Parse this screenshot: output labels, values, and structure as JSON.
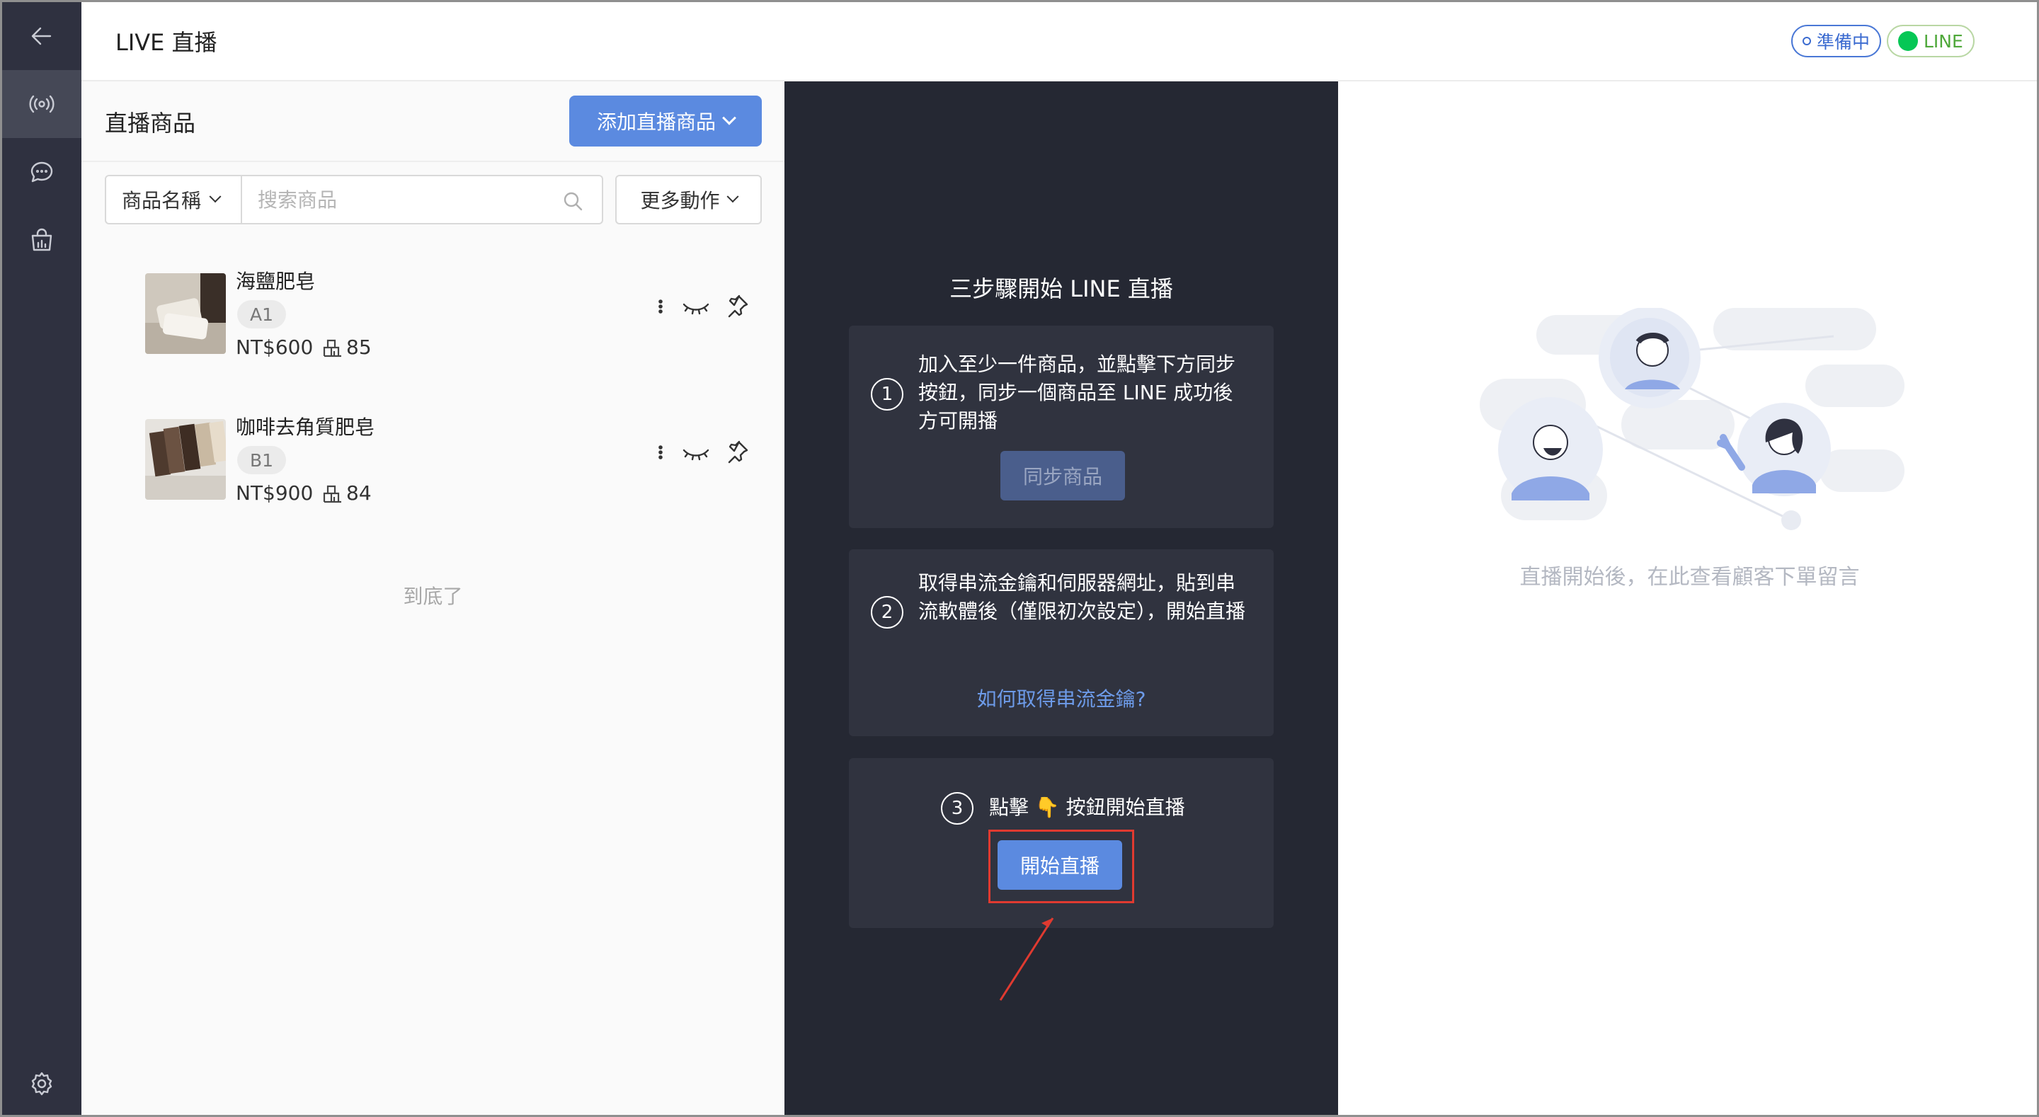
{
  "header": {
    "title": "LIVE 直播",
    "status_label": "準備中",
    "channel_label": "LINE",
    "channel_icon_text": "LINE"
  },
  "sidebar": {
    "items": [
      {
        "icon": "back-arrow-icon"
      },
      {
        "icon": "live-broadcast-icon",
        "active": true
      },
      {
        "icon": "chat-icon"
      },
      {
        "icon": "shop-bag-icon"
      },
      {
        "icon": "gear-icon"
      }
    ]
  },
  "products_panel": {
    "title": "直播商品",
    "add_button_label": "添加直播商品",
    "filter_label": "商品名稱",
    "search_placeholder": "搜索商品",
    "more_actions_label": "更多動作",
    "items": [
      {
        "name": "海鹽肥皂",
        "code": "A1",
        "price": "NT$600",
        "stock": "85"
      },
      {
        "name": "咖啡去角質肥皂",
        "code": "B1",
        "price": "NT$900",
        "stock": "84"
      }
    ],
    "end_text": "到底了"
  },
  "steps_panel": {
    "title": "三步驟開始 LINE 直播",
    "steps": [
      {
        "num": "1",
        "text": "加入至少一件商品，並點擊下方同步按鈕，同步一個商品至 LINE 成功後方可開播",
        "button_label": "同步商品"
      },
      {
        "num": "2",
        "text": "取得串流金鑰和伺服器網址，貼到串流軟體後（僅限初次設定），開始直播",
        "link_label": "如何取得串流金鑰?"
      },
      {
        "num": "3",
        "text": "點擊 👇 按鈕開始直播",
        "button_label": "開始直播"
      }
    ]
  },
  "comments_panel": {
    "hint": "直播開始後，在此查看顧客下單留言"
  },
  "colors": {
    "accent": "#5b8ae0",
    "rail": "#2f3140",
    "dark_panel": "#252833",
    "card": "#30333f",
    "highlight": "#e03a30"
  }
}
